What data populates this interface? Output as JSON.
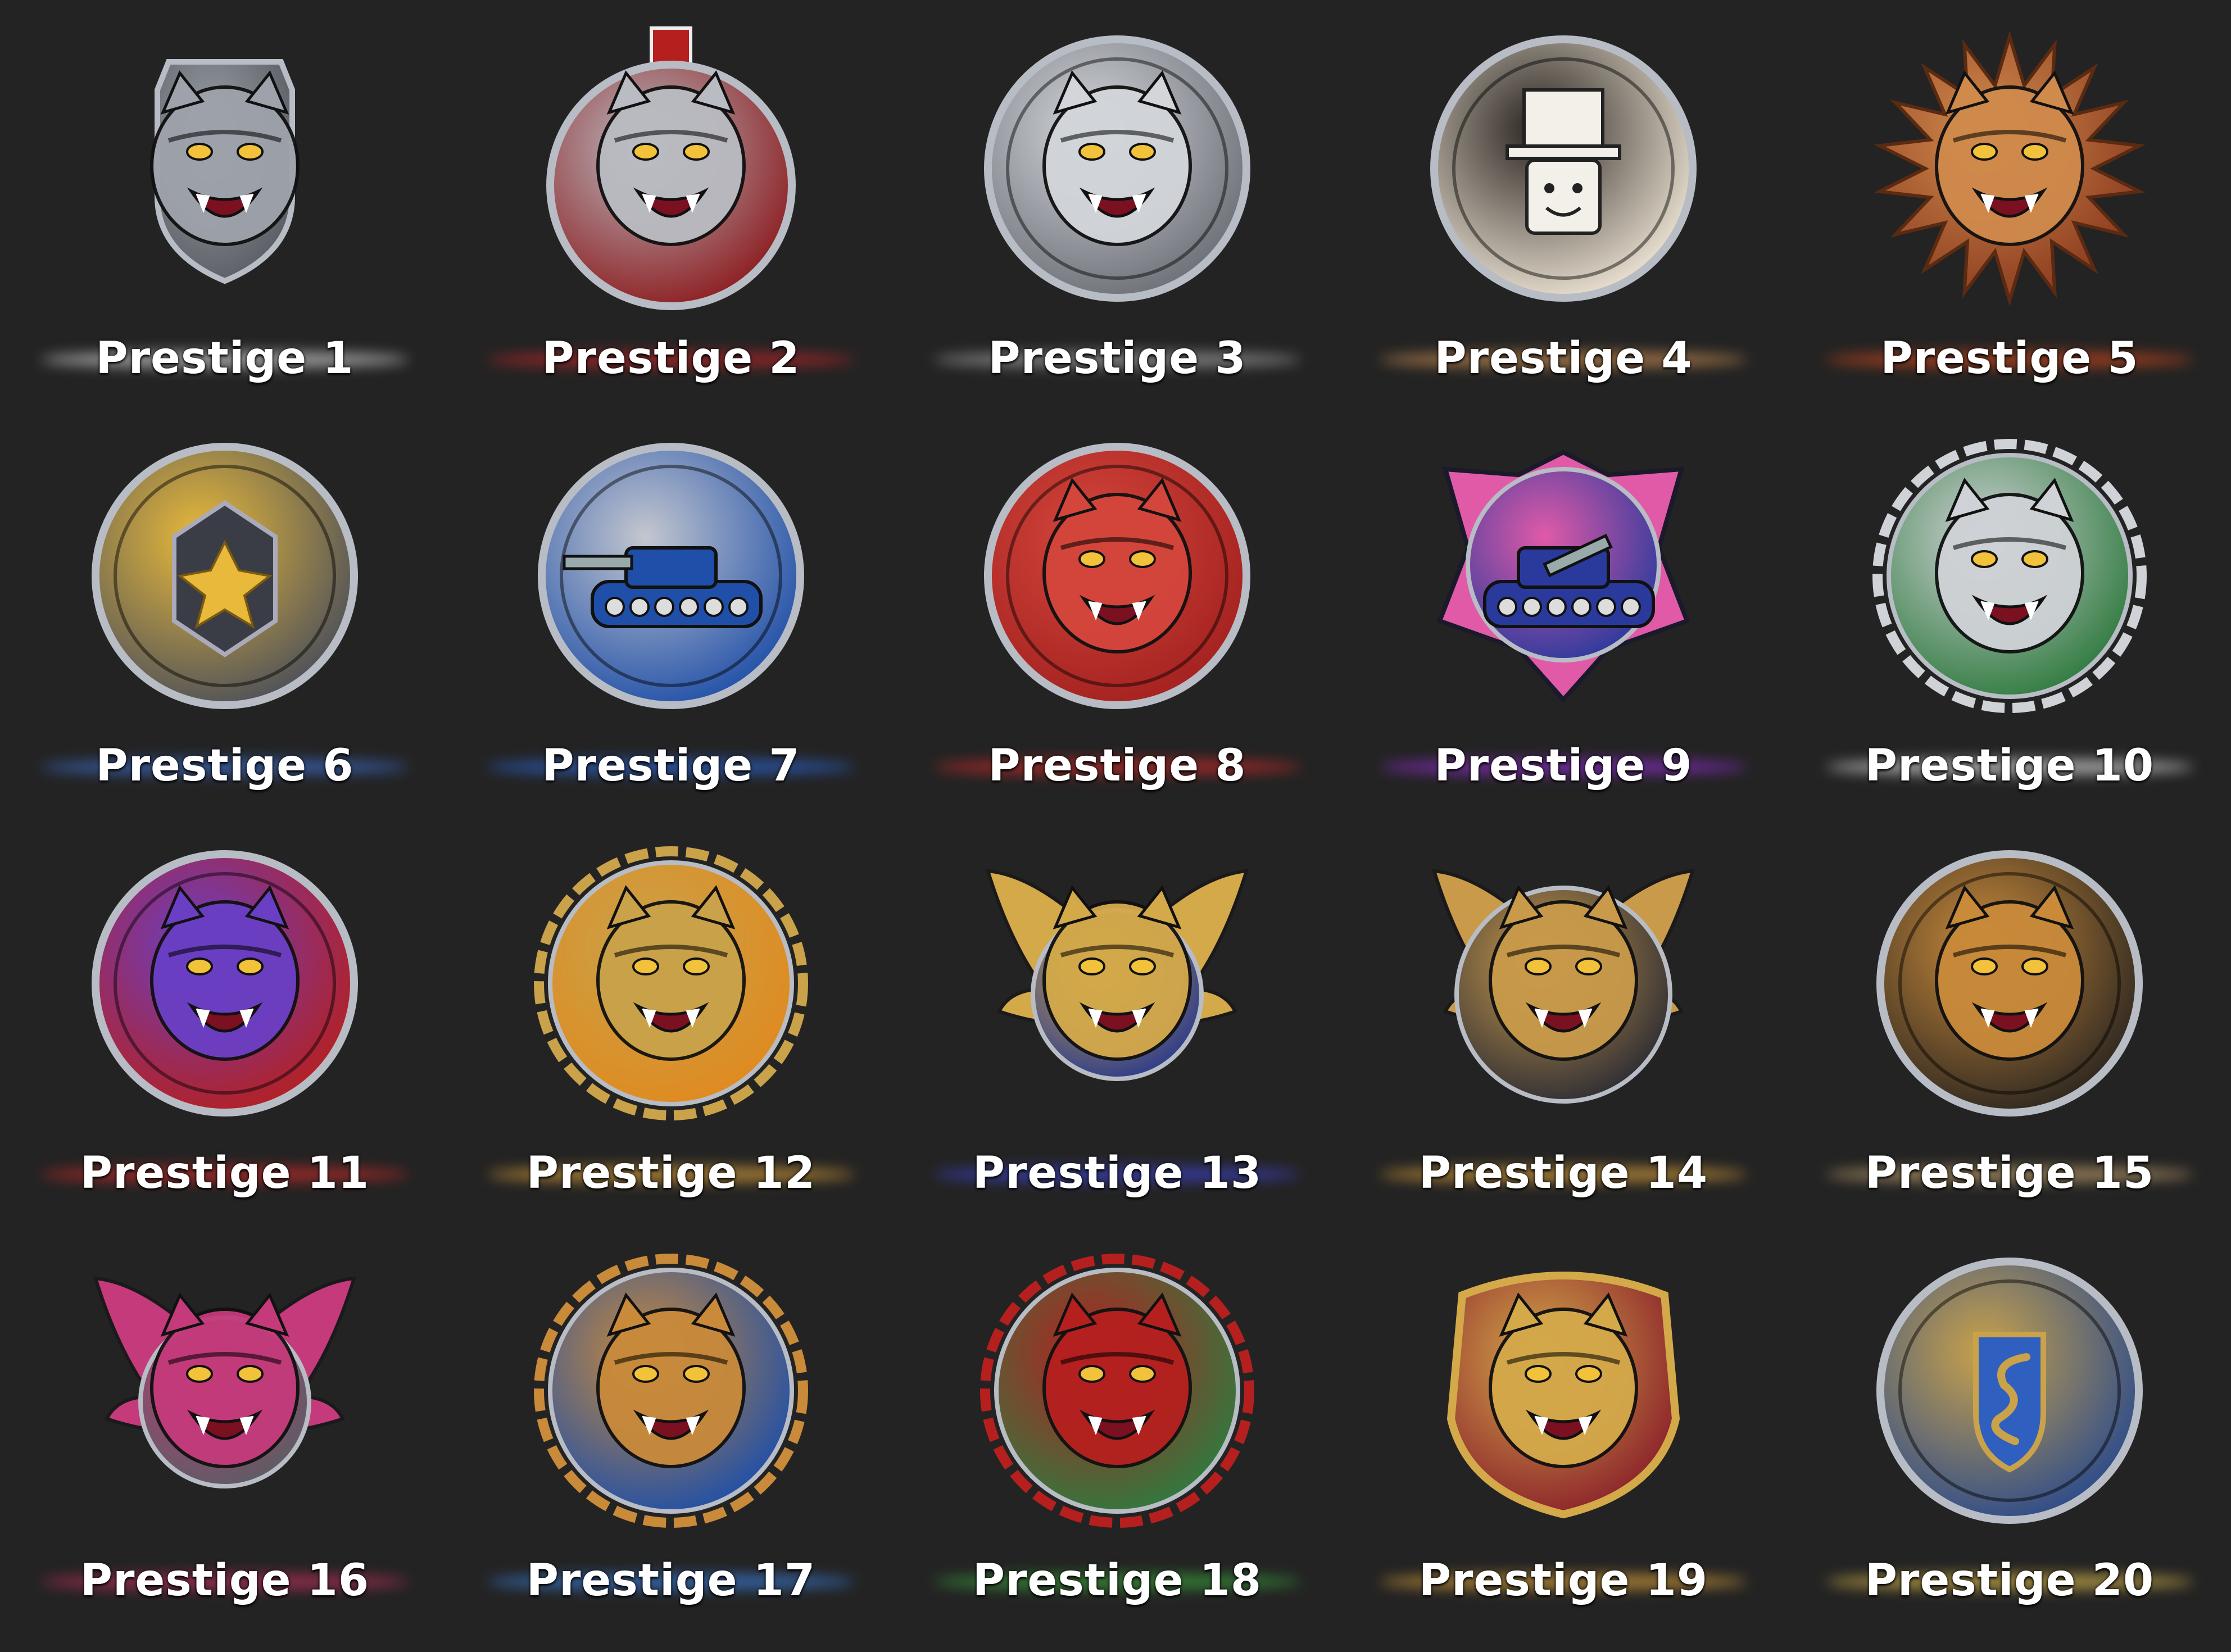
{
  "badges": [
    {
      "label": "Prestige 1",
      "glow": "#c9c9c9",
      "primary": "#5a5d63",
      "accent": "#9ea3ab",
      "shape": "shield",
      "icon": "dragon-icon"
    },
    {
      "label": "Prestige 2",
      "glow": "#b3262a",
      "primary": "#8c1b1e",
      "accent": "#b9bcc2",
      "shape": "medal",
      "icon": "robot-panther-icon"
    },
    {
      "label": "Prestige 3",
      "glow": "#9a9a9a",
      "primary": "#6b6e75",
      "accent": "#d2d5da",
      "shape": "circle",
      "icon": "mech-wolf-icon"
    },
    {
      "label": "Prestige 4",
      "glow": "#c48a52",
      "primary": "#efe6d6",
      "accent": "#2a2420",
      "shape": "circle",
      "icon": "avatar-top-hat-icon"
    },
    {
      "label": "Prestige 5",
      "glow": "#c2461c",
      "primary": "#8a3a1e",
      "accent": "#d08a4c",
      "shape": "spiky",
      "icon": "flame-crest-icon"
    },
    {
      "label": "Prestige 6",
      "glow": "#3d6bc4",
      "primary": "#4b4f5a",
      "accent": "#e8b93a",
      "shape": "circle",
      "icon": "star-gem-icon"
    },
    {
      "label": "Prestige 7",
      "glow": "#2d62c9",
      "primary": "#1f4fa8",
      "accent": "#c4c7cf",
      "shape": "circle",
      "icon": "tank-icon"
    },
    {
      "label": "Prestige 8",
      "glow": "#c22a2a",
      "primary": "#a3211f",
      "accent": "#d4463c",
      "shape": "circle",
      "icon": "bear-wolf-icon"
    },
    {
      "label": "Prestige 9",
      "glow": "#8a2dc4",
      "primary": "#2a3a9c",
      "accent": "#e05aa8",
      "shape": "star-shield",
      "icon": "artillery-tank-icon"
    },
    {
      "label": "Prestige 10",
      "glow": "#cfcfcf",
      "primary": "#2f7a3e",
      "accent": "#cfd2d6",
      "shape": "ornate",
      "icon": "white-tiger-icon"
    },
    {
      "label": "Prestige 11",
      "glow": "#c22a2a",
      "primary": "#b5201f",
      "accent": "#6a3fc4",
      "shape": "circle",
      "icon": "dinosaur-icon"
    },
    {
      "label": "Prestige 12",
      "glow": "#d19a3a",
      "primary": "#e08a1f",
      "accent": "#c9a24a",
      "shape": "ornate",
      "icon": "tiger-icon"
    },
    {
      "label": "Prestige 13",
      "glow": "#3d42c4",
      "primary": "#2a3a8c",
      "accent": "#d4a94a",
      "shape": "wings",
      "icon": "winged-beast-icon"
    },
    {
      "label": "Prestige 14",
      "glow": "#d19a3a",
      "primary": "#2c2c34",
      "accent": "#c99a4a",
      "shape": "wings-circle",
      "icon": "eagle-icon"
    },
    {
      "label": "Prestige 15",
      "glow": "#b89a6a",
      "primary": "#2a2520",
      "accent": "#c98a3a",
      "shape": "circle",
      "icon": "beasts-icon"
    },
    {
      "label": "Prestige 16",
      "glow": "#b8305a",
      "primary": "#5a5d63",
      "accent": "#c43a7a",
      "shape": "wings",
      "icon": "bull-icon"
    },
    {
      "label": "Prestige 17",
      "glow": "#3a7ad0",
      "primary": "#1f4fa8",
      "accent": "#c98a3a",
      "shape": "ornate",
      "icon": "dragon-head-icon"
    },
    {
      "label": "Prestige 18",
      "glow": "#3a9a3a",
      "primary": "#2f7a3e",
      "accent": "#b5201f",
      "shape": "ornate",
      "icon": "serpents-icon"
    },
    {
      "label": "Prestige 19",
      "glow": "#d19a3a",
      "primary": "#8a1f2a",
      "accent": "#d4a94a",
      "shape": "crest",
      "icon": "lion-icon"
    },
    {
      "label": "Prestige 20",
      "glow": "#d1b24a",
      "primary": "#2a4a8c",
      "accent": "#c9a24a",
      "shape": "circle",
      "icon": "snake-emblem-icon"
    }
  ]
}
